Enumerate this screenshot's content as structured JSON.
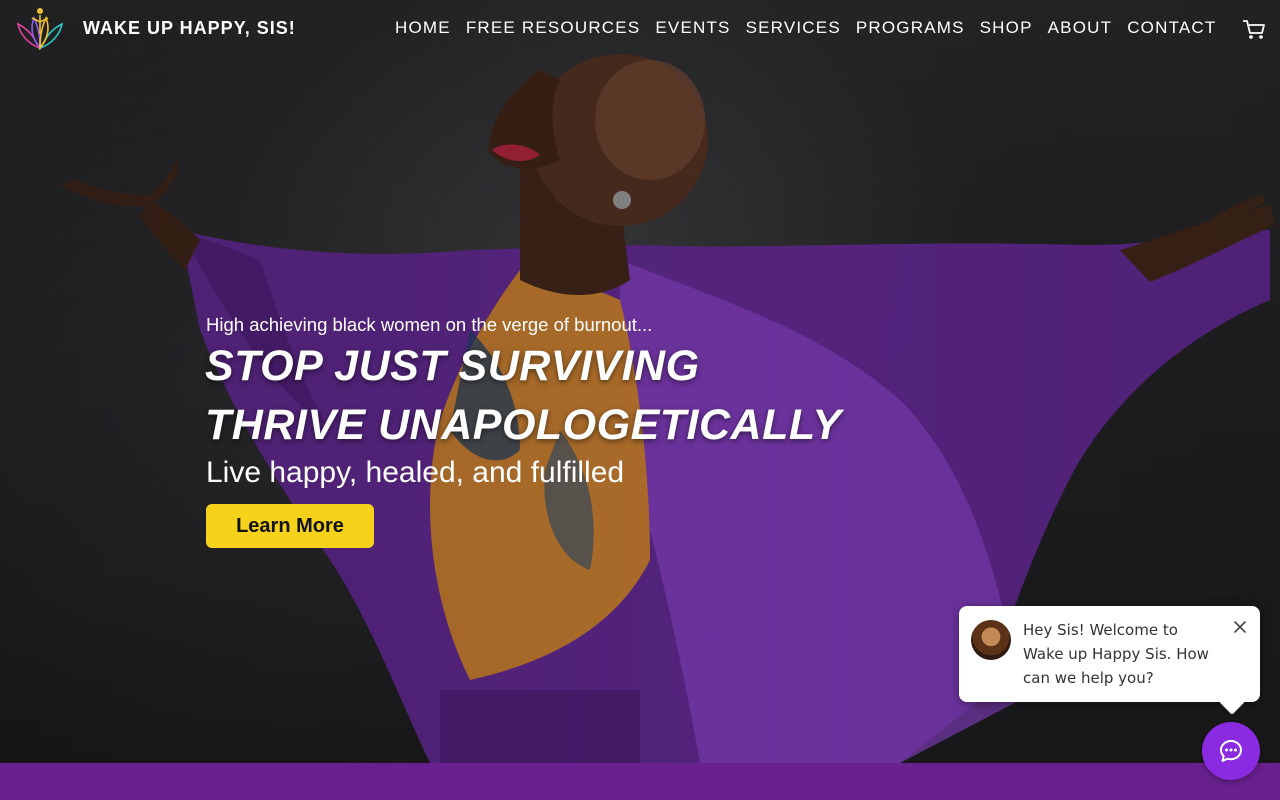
{
  "header": {
    "brand": "WAKE UP HAPPY, SIS!",
    "logo_icon": "lotus-figure-icon",
    "nav": [
      {
        "label": "HOME"
      },
      {
        "label": "FREE RESOURCES"
      },
      {
        "label": "EVENTS"
      },
      {
        "label": "SERVICES"
      },
      {
        "label": "PROGRAMS"
      },
      {
        "label": "SHOP"
      },
      {
        "label": "ABOUT"
      },
      {
        "label": "CONTACT"
      }
    ],
    "cart_icon": "cart-icon"
  },
  "hero": {
    "eyebrow": "High achieving black women on the verge of burnout...",
    "headline_1": "STOP JUST SURVIVING",
    "headline_2": "THRIVE UNAPOLOGETICALLY",
    "subheadline": "Live happy, healed, and fulfilled",
    "cta_label": "Learn More"
  },
  "chat": {
    "message": "Hey Sis! Welcome to Wake up Happy Sis. How can we help you?",
    "close_icon": "close-icon",
    "launcher_icon": "chat-icon"
  },
  "colors": {
    "cta": "#f7d21b",
    "band": "#6a2190",
    "chat_launcher": "#8a2be2",
    "robe": "#6b2fa0"
  }
}
